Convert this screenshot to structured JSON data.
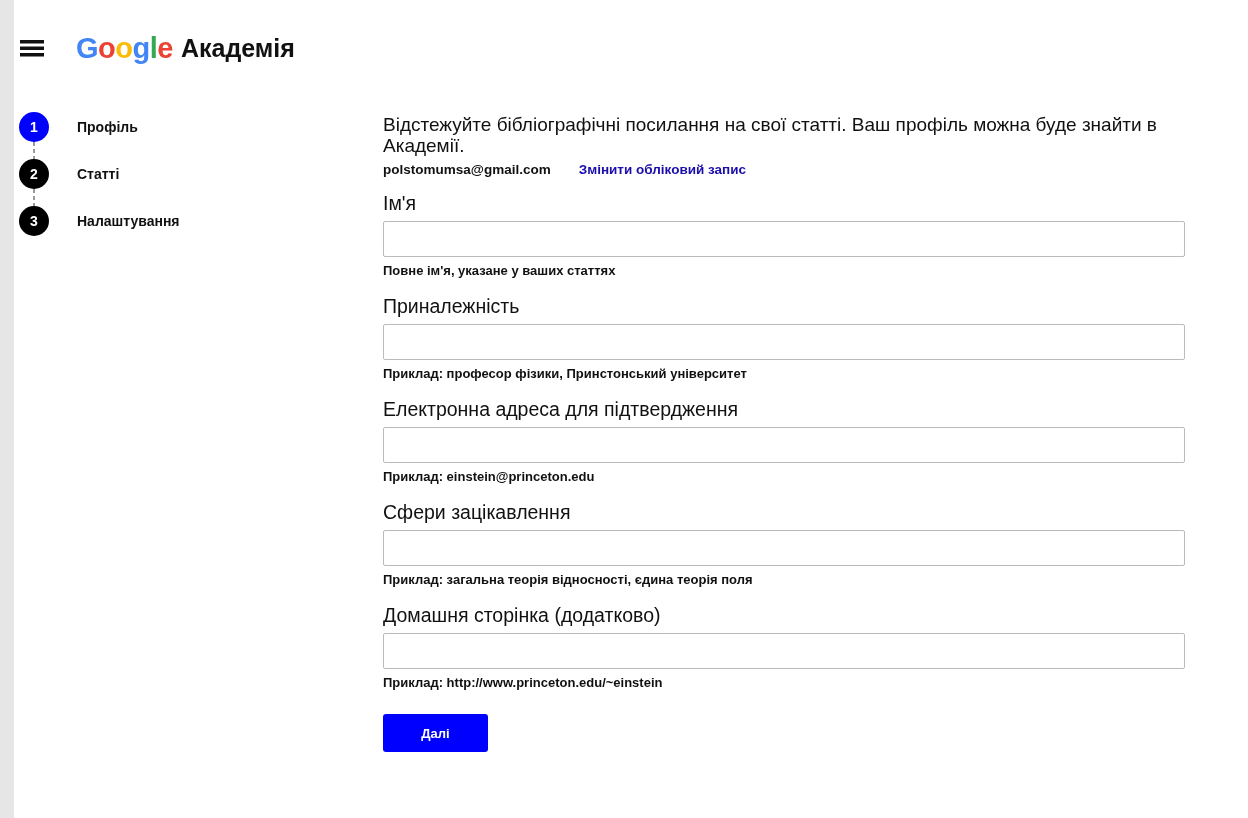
{
  "header": {
    "logo": "Google",
    "title": "Академія"
  },
  "steps": [
    {
      "number": "1",
      "label": "Профіль",
      "selected": true
    },
    {
      "number": "2",
      "label": "Статті",
      "selected": false
    },
    {
      "number": "3",
      "label": "Налаштування",
      "selected": false
    }
  ],
  "intro": "Відстежуйте бібліографічні посилання на свої статті. Ваш профіль можна буде знайти в Академії.",
  "account": {
    "email": "polstomumsa@gmail.com",
    "change_link": "Змінити обліковий запис"
  },
  "fields": [
    {
      "label": "Ім'я",
      "hint": "Повне ім'я, указане у ваших статтях"
    },
    {
      "label": "Приналежність",
      "hint": "Приклад: професор фізики, Принстонський університет"
    },
    {
      "label": "Електронна адреса для підтвердження",
      "hint": "Приклад: einstein@princeton.edu"
    },
    {
      "label": "Сфери зацікавлення",
      "hint": "Приклад: загальна теорія відносності, єдина теорія поля"
    },
    {
      "label": "Домашня сторінка (додатково)",
      "hint": "Приклад: http://www.princeton.edu/~einstein"
    }
  ],
  "next_button": "Далі"
}
